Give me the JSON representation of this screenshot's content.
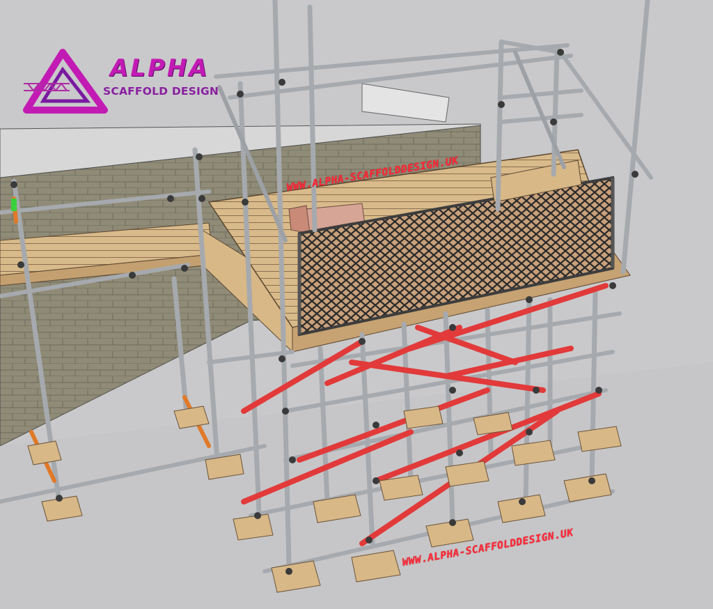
{
  "logo": {
    "title": "ALPHA",
    "subtitle": "SCAFFOLD DESIGN"
  },
  "watermarks": {
    "top": "WWW.ALPHA-SCAFFOLDDESIGN.UK",
    "bottom": "WWW.ALPHA-SCAFFOLDDESIGN.UK"
  },
  "colors": {
    "background": "#c9c9cb",
    "tube": "#a9adb1",
    "brace": "#e23a3a",
    "board": "#d8b887",
    "brick": "#8e8a76",
    "logo_magenta": "#c21bb4",
    "watermark": "#ff2a3a"
  }
}
